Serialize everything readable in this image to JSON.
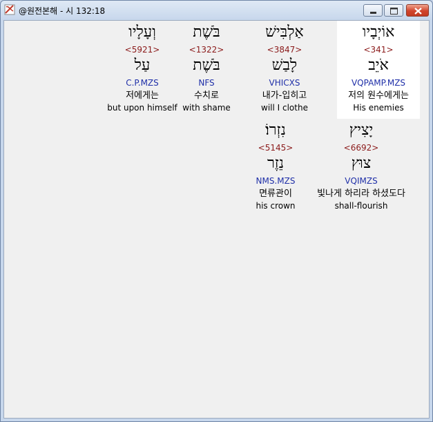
{
  "window": {
    "title": "@원전본해 - 시 132:18"
  },
  "words": [
    {
      "hebrew": "אוֹיְבָיו",
      "strong": "<341>",
      "lemma": "אֹיֵב",
      "morph": "VQPAMP.MZS",
      "korean": "저의 원수에게는",
      "english": "His enemies"
    },
    {
      "hebrew": "אַלְבִּישׁ",
      "strong": "<3847>",
      "lemma": "לָבַשׁ",
      "morph": "VHICXS",
      "korean": "내가-입히고",
      "english": "will I clothe"
    },
    {
      "hebrew": "בֹּשֶׁת",
      "strong": "<1322>",
      "lemma": "בֹּשֶׁת",
      "morph": "NFS",
      "korean": "수치로",
      "english": "with shame"
    },
    {
      "hebrew": "וְעָלָיו",
      "strong": "<5921>",
      "lemma": "עַל",
      "morph": "C.P.MZS",
      "korean": "저에게는",
      "english": "but upon himself"
    },
    {
      "hebrew": "יָצִיץ",
      "strong": "<6692>",
      "lemma": "צוּץ",
      "morph": "VQIMZS",
      "korean": "빛나게 하리라 하셨도다",
      "english": "shall-flourish"
    },
    {
      "hebrew": "נִזְרוֹ׃",
      "strong": "<5145>",
      "lemma": "נֵזֶר",
      "morph": "NMS.MZS",
      "korean": "면류관이",
      "english": "his crown"
    }
  ]
}
